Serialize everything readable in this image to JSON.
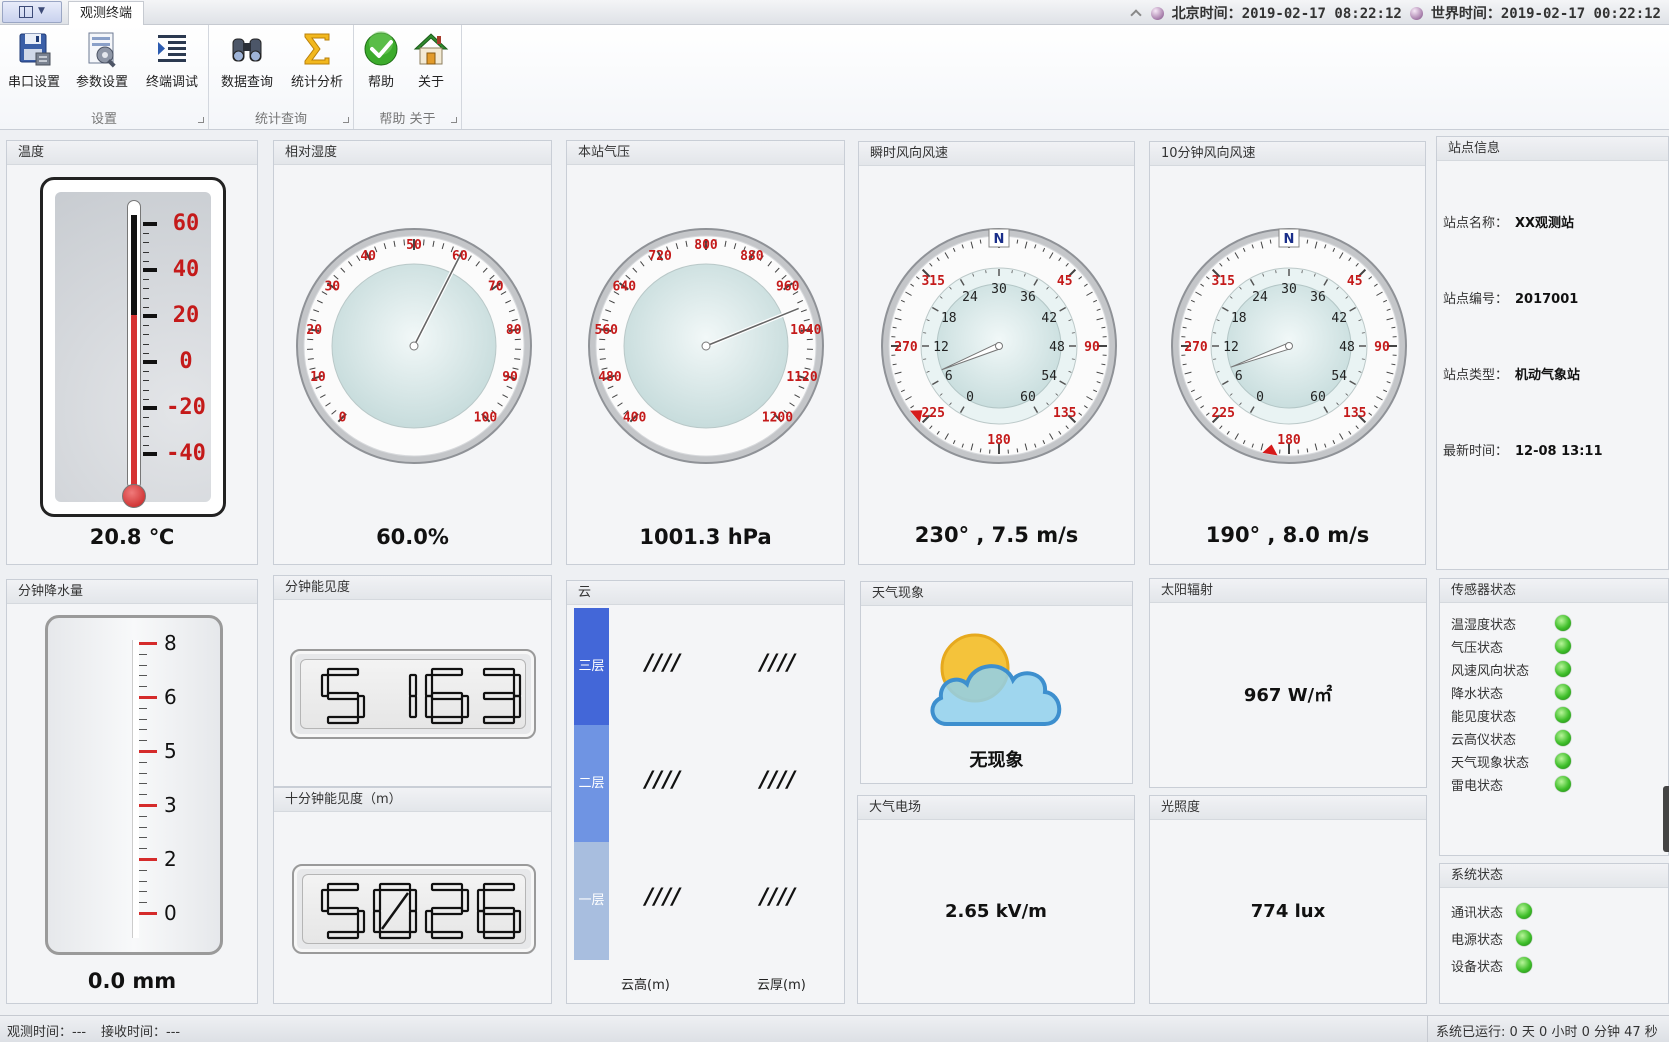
{
  "window": {
    "tab": "观测终端"
  },
  "clock": {
    "beijing_label": "北京时间：",
    "beijing_value": "2019-02-17 08:22:12",
    "world_label": "世界时间：",
    "world_value": "2019-02-17 00:22:12"
  },
  "ribbon": {
    "groups": [
      {
        "label": "设置",
        "buttons": [
          "串口设置",
          "参数设置",
          "终端调试"
        ]
      },
      {
        "label": "统计查询",
        "buttons": [
          "数据查询",
          "统计分析"
        ]
      },
      {
        "label": "帮助 关于",
        "buttons": [
          "帮助",
          "关于"
        ]
      }
    ]
  },
  "temperature": {
    "title": "温度",
    "scale": [
      "60",
      "40",
      "20",
      "0",
      "-20",
      "-40"
    ],
    "value": "20.8 ℃",
    "reading_c": 20.8
  },
  "humidity": {
    "title": "相对湿度",
    "ticks": [
      "0",
      "10",
      "20",
      "30",
      "40",
      "50",
      "60",
      "70",
      "80",
      "90",
      "100"
    ],
    "value": "60.0%",
    "reading": 60
  },
  "pressure": {
    "title": "本站气压",
    "ticks": [
      "400",
      "480",
      "560",
      "640",
      "720",
      "800",
      "880",
      "960",
      "1040",
      "1120",
      "1200"
    ],
    "value": "1001.3 hPa",
    "reading": 1001.3
  },
  "wind_instant": {
    "title": "瞬时风向风速",
    "outer_ticks": [
      "45",
      "90",
      "135",
      "180",
      "225",
      "270",
      "315"
    ],
    "north": "N",
    "inner_ticks": [
      "0",
      "6",
      "12",
      "18",
      "24",
      "30",
      "36",
      "42",
      "48",
      "54",
      "60"
    ],
    "direction_deg": 230,
    "speed": 7.5,
    "value": "230° , 7.5 m/s"
  },
  "wind_10min": {
    "title": "10分钟风向风速",
    "outer_ticks": [
      "45",
      "90",
      "135",
      "180",
      "225",
      "270",
      "315"
    ],
    "north": "N",
    "inner_ticks": [
      "0",
      "6",
      "12",
      "18",
      "24",
      "30",
      "36",
      "42",
      "48",
      "54",
      "60"
    ],
    "direction_deg": 190,
    "speed": 8.0,
    "value": "190° , 8.0 m/s"
  },
  "station": {
    "title": "站点信息",
    "rows": [
      {
        "k": "站点名称：",
        "v": "XX观测站"
      },
      {
        "k": "站点编号：",
        "v": "2017001"
      },
      {
        "k": "站点类型：",
        "v": "机动气象站"
      },
      {
        "k": "最新时间：",
        "v": "12-08 13:11"
      }
    ]
  },
  "rain": {
    "title": "分钟降水量",
    "scale": [
      "8",
      "6",
      "5",
      "3",
      "2",
      "0"
    ],
    "value": "0.0 mm"
  },
  "visibility_1min": {
    "title": "分钟能见度",
    "value": "5163"
  },
  "visibility_10min": {
    "title": "十分钟能见度（m）",
    "value": "5026"
  },
  "cloud": {
    "title": "云",
    "layers": [
      "三层",
      "二层",
      "一层"
    ],
    "height_values": [
      "////",
      "////",
      "////"
    ],
    "thick_values": [
      "////",
      "////",
      "////"
    ],
    "col_height": "云高(m)",
    "col_thick": "云厚(m)",
    "colors": [
      "#4367d8",
      "#6f94e3",
      "#a8bedf"
    ]
  },
  "weather": {
    "title": "天气现象",
    "value": "无现象",
    "icon": "partly-cloudy-icon"
  },
  "solar": {
    "title": "太阳辐射",
    "value": "967 W/㎡"
  },
  "efield": {
    "title": "大气电场",
    "value": "2.65 kV/m"
  },
  "lux": {
    "title": "光照度",
    "value": "774 lux"
  },
  "sensors": {
    "title": "传感器状态",
    "items": [
      "温湿度状态",
      "气压状态",
      "风速风向状态",
      "降水状态",
      "能见度状态",
      "云高仪状态",
      "天气现象状态",
      "雷电状态"
    ]
  },
  "system": {
    "title": "系统状态",
    "items": [
      "通讯状态",
      "电源状态",
      "设备状态"
    ]
  },
  "statusbar": {
    "obs_label": "观测时间：",
    "obs_value": "---",
    "recv_label": "接收时间：",
    "recv_value": "---",
    "uptime": "系统已运行: 0 天 0 小时 0 分钟 47 秒"
  }
}
